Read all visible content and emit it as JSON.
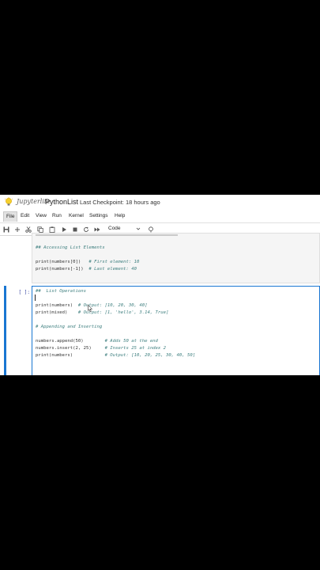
{
  "app": {
    "logo_text": "Jupyterlite",
    "notebook_name": "PythonList",
    "checkpoint": "Last Checkpoint: 18 hours ago"
  },
  "menu": [
    "File",
    "Edit",
    "View",
    "Run",
    "Kernel",
    "Settings",
    "Help"
  ],
  "toolbar": {
    "icons": [
      "save-icon",
      "add-cell-icon",
      "cut-icon",
      "copy-icon",
      "paste-icon",
      "run-icon",
      "stop-icon",
      "restart-icon",
      "fast-forward-icon"
    ],
    "cell_type": "Code",
    "kernel_status_icon": "kernel-idle-icon"
  },
  "cells": [
    {
      "prompt": "",
      "lines": [
        "## Accessing List Elements",
        "",
        "print(numbers[0])   # First element: 10",
        "print(numbers[-1])  # Last element: 40"
      ]
    },
    {
      "prompt": "[ ]:",
      "lines": [
        "##  List Operations",
        "",
        "",
        "print(numbers)  # Output: [10, 20, 30, 40]",
        "print(mixed)    # Output: [1, 'hello', 3.14, True]",
        "",
        "# Appending and Inserting",
        "",
        "",
        "numbers.append(50)        # Adds 50 at the end",
        "numbers.insert(2, 25)     # Inserts 25 at index 2",
        "print(numbers)            # Output: [10, 20, 25, 30, 40, 50]"
      ]
    }
  ],
  "colors": {
    "active_cell_bar": "#1976d2",
    "comment": "#408080",
    "prompt": "#303f9f"
  }
}
